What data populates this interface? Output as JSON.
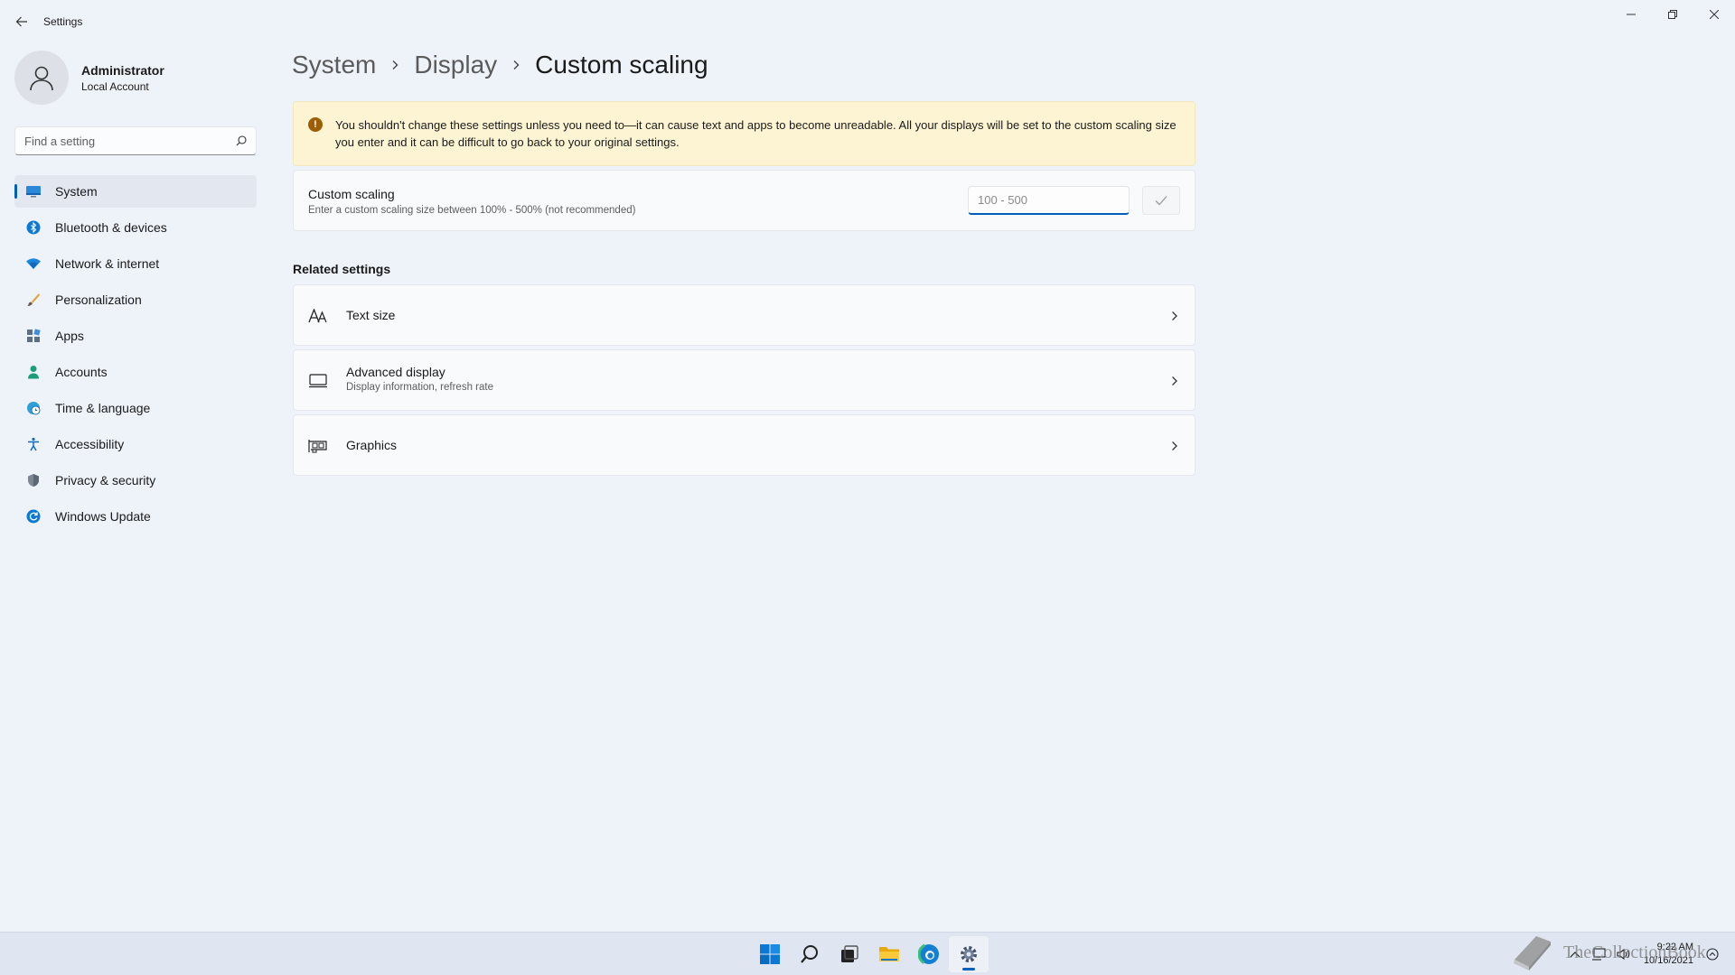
{
  "window": {
    "app_title": "Settings"
  },
  "profile": {
    "name": "Administrator",
    "account_type": "Local Account"
  },
  "search": {
    "placeholder": "Find a setting"
  },
  "nav": {
    "items": [
      {
        "label": "System",
        "icon": "system-icon",
        "active": true
      },
      {
        "label": "Bluetooth & devices",
        "icon": "bluetooth-icon"
      },
      {
        "label": "Network & internet",
        "icon": "wifi-icon"
      },
      {
        "label": "Personalization",
        "icon": "brush-icon"
      },
      {
        "label": "Apps",
        "icon": "apps-icon"
      },
      {
        "label": "Accounts",
        "icon": "accounts-icon"
      },
      {
        "label": "Time & language",
        "icon": "globe-clock-icon"
      },
      {
        "label": "Accessibility",
        "icon": "accessibility-icon"
      },
      {
        "label": "Privacy & security",
        "icon": "shield-icon"
      },
      {
        "label": "Windows Update",
        "icon": "update-icon"
      }
    ]
  },
  "breadcrumb": {
    "items": [
      "System",
      "Display",
      "Custom scaling"
    ]
  },
  "warning": {
    "text": "You shouldn't change these settings unless you need to—it can cause text and apps to become unreadable. All your displays will be set to the custom scaling size you enter and it can be difficult to go back to your original settings."
  },
  "custom_scaling": {
    "title": "Custom scaling",
    "description": "Enter a custom scaling size between 100% - 500% (not recommended)",
    "input_placeholder": "100 - 500",
    "input_value": ""
  },
  "related": {
    "heading": "Related settings",
    "items": [
      {
        "title": "Text size",
        "subtitle": "",
        "icon": "text-size-icon"
      },
      {
        "title": "Advanced display",
        "subtitle": "Display information, refresh rate",
        "icon": "monitor-icon"
      },
      {
        "title": "Graphics",
        "subtitle": "",
        "icon": "graphics-card-icon"
      }
    ]
  },
  "taskbar": {
    "time": "9:22 AM",
    "date": "10/16/2021"
  },
  "watermark": {
    "text": "TheCollectionBook"
  },
  "colors": {
    "accent": "#005fb8",
    "warning_bg": "#fdf4d3",
    "warning_icon": "#9d5d00",
    "background": "#eef2f9"
  }
}
